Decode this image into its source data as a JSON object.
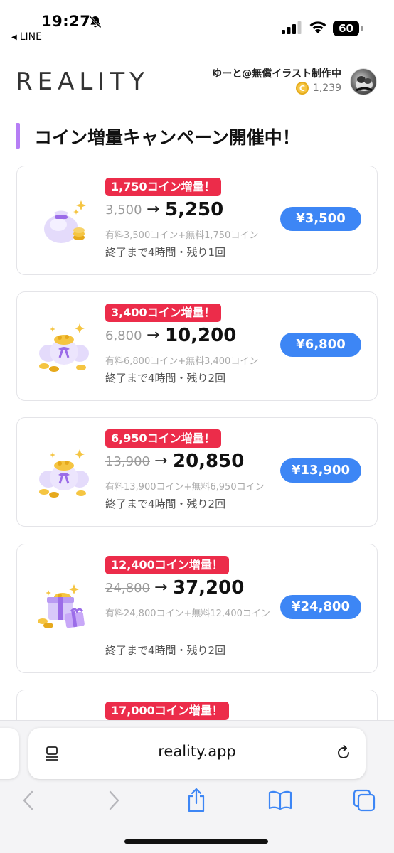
{
  "status_bar": {
    "time": "19:27",
    "back_app": "LINE",
    "battery": "60"
  },
  "header": {
    "logo": "REALITY",
    "user_name": "ゆーと@無償イラスト制作中",
    "coin_symbol": "C",
    "coin_balance": "1,239"
  },
  "campaign": {
    "title": "コイン増量キャンペーン開催中！",
    "accent_color": "#b67ef5"
  },
  "offers": [
    {
      "badge": "1,750コイン増量！",
      "old_amount": "3,500",
      "arrow": "→",
      "new_amount": "5,250",
      "breakdown": "有料3,500コイン+無料1,750コイン",
      "remaining": "終了まで4時間・残り1回",
      "price": "¥3,500",
      "icon": "single-coin-bag-icon"
    },
    {
      "badge": "3,400コイン増量！",
      "old_amount": "6,800",
      "arrow": "→",
      "new_amount": "10,200",
      "breakdown": "有料6,800コイン+無料3,400コイン",
      "remaining": "終了まで4時間・残り2回",
      "price": "¥6,800",
      "icon": "multi-coin-bags-icon"
    },
    {
      "badge": "6,950コイン増量！",
      "old_amount": "13,900",
      "arrow": "→",
      "new_amount": "20,850",
      "breakdown": "有料13,900コイン+無料6,950コイン",
      "remaining": "終了まで4時間・残り2回",
      "price": "¥13,900",
      "icon": "multi-coin-bags-icon"
    },
    {
      "badge": "12,400コイン増量！",
      "old_amount": "24,800",
      "arrow": "→",
      "new_amount": "37,200",
      "breakdown": "有料24,800コイン+無料12,400コイン",
      "remaining": "終了まで4時間・残り2回",
      "price": "¥24,800",
      "icon": "coin-gift-boxes-icon"
    },
    {
      "badge": "17,000コイン増量！"
    }
  ],
  "browser": {
    "url": "reality.app"
  },
  "colors": {
    "badge_red": "#ec2c4a",
    "price_blue": "#3d86f5",
    "coin_gold": "#f5c542"
  }
}
